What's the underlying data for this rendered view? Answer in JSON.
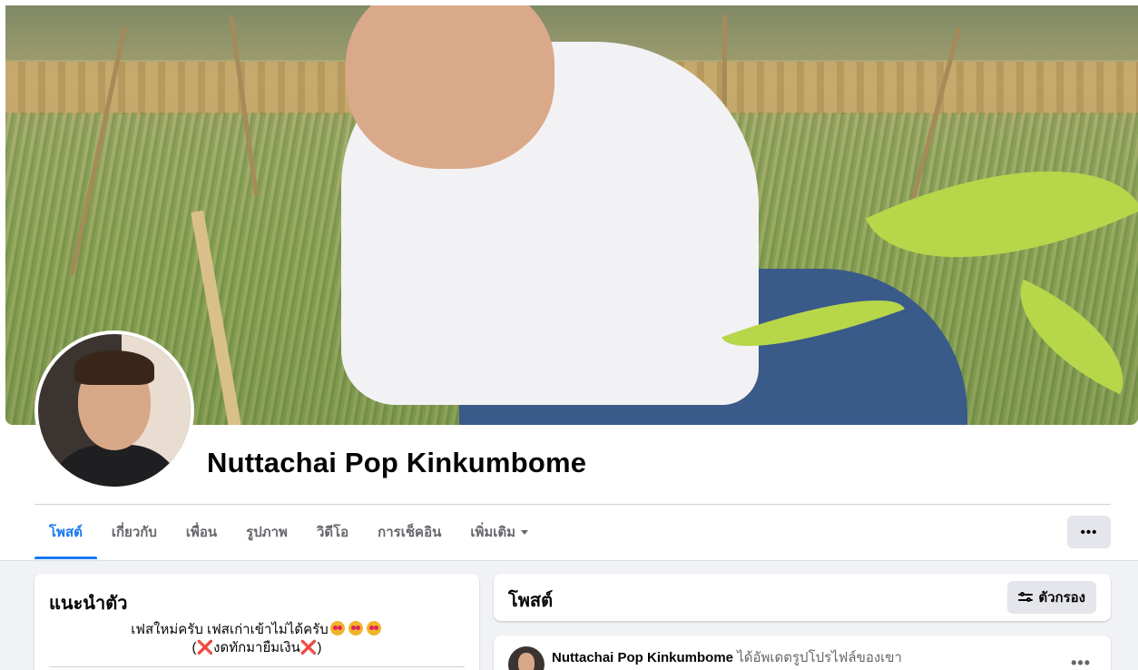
{
  "profile": {
    "name": "Nuttachai Pop Kinkumbome"
  },
  "tabs": [
    {
      "label": "โพสต์"
    },
    {
      "label": "เกี่ยวกับ"
    },
    {
      "label": "เพื่อน"
    },
    {
      "label": "รูปภาพ"
    },
    {
      "label": "วิดีโอ"
    },
    {
      "label": "การเช็คอิน"
    },
    {
      "label": "เพิ่มเติม"
    }
  ],
  "more_button": {
    "label": "•••"
  },
  "intro": {
    "title": "แนะนำตัว",
    "bio_line1": "เฟสใหม่ครับ เฟสเก่าเข้าไม่ได้ครับ",
    "bio_line2_open": "(",
    "bio_line2_text": "งดทักมายืมเงิน",
    "bio_line2_close": ")",
    "cross_glyph": "❌"
  },
  "posts": {
    "title": "โพสต์",
    "filter_label": "ตัวกรอง",
    "first_post": {
      "author": "Nuttachai Pop Kinkumbome",
      "action": "ได้อัพเดตรูปโปรไฟล์ของเขา",
      "menu": "•••"
    }
  },
  "colors": {
    "accent": "#1877f2",
    "page_bg": "#f0f2f5",
    "button_bg": "#e4e6eb",
    "text_secondary": "#65676b"
  }
}
